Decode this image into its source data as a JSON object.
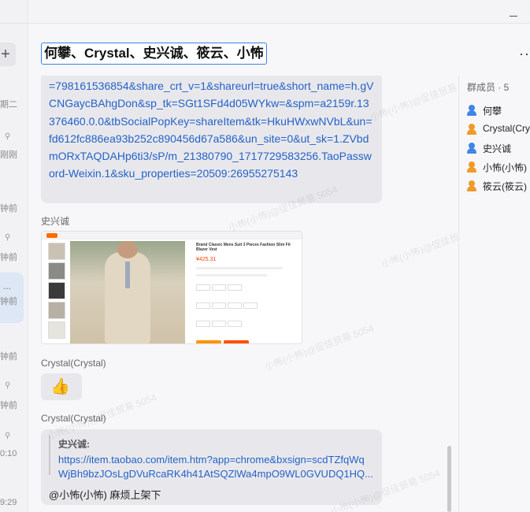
{
  "left_panel": {
    "plus_label": "+",
    "conversations": [
      {
        "name": "",
        "time": "期二"
      },
      {
        "name": "",
        "time": "刚刚"
      },
      {
        "name": "",
        "time": "钟前"
      },
      {
        "name": "",
        "time": "钟前"
      },
      {
        "name": "...",
        "time": "钟前"
      },
      {
        "name": "",
        "time": "钟前"
      },
      {
        "name": "",
        "time": "钟前"
      },
      {
        "name": "",
        "time": "0:10"
      },
      {
        "name": "",
        "time": "9:29"
      }
    ]
  },
  "header": {
    "title": "何攀、Crystal、史兴诚、筱云、小怖",
    "more_label": "··"
  },
  "messages": {
    "link_message": "=798161536854&share_crt_v=1&shareurl=true&short_name=h.gVCNGaycBAhgDon&sp_tk=SGt1SFd4d05WYkw=&spm=a2159r.13376460.0.0&tbSocialPopKey=shareItem&tk=HkuHWxwNVbL&un=fd612fc886ea93b252c890456d67a586&un_site=0&ut_sk=1.ZVbdmORxTAQDAHp6ti3/sP/m_21380790_1717729583256.TaoPassword-Weixin.1&sku_properties=20509:26955275143",
    "image_sender": "史兴诚",
    "image_card": {
      "product_title": "Brand Classic Mens Suit 3 Pieces Fashion Slim Fit Blazer Vest",
      "price": "¥425.31"
    },
    "emoji_sender": "Crystal(Crystal)",
    "emoji": "👍",
    "quote_sender": "Crystal(Crystal)",
    "quote": {
      "from": "史兴诚:",
      "link": "https://item.taobao.com/item.htm?app=chrome&bxsign=scdTZfqWqWjBh9bzJOsLgDVuRcaRK4h41AtSQZlWa4mpO9WL0GVUDQ1HQ...",
      "reply": "@小怖(小怖)  麻烦上架下"
    },
    "watermark": "小怖(小怖)@促佳贸易 5054"
  },
  "members": {
    "heading": "群成员 · 5",
    "list": [
      {
        "name": "何攀",
        "color": "blue"
      },
      {
        "name": "Crystal(Crystal)",
        "color": "orange"
      },
      {
        "name": "史兴诚",
        "color": "blue"
      },
      {
        "name": "小怖(小怖)",
        "color": "orange"
      },
      {
        "name": "筱云(筱云)",
        "color": "orange"
      }
    ]
  },
  "colors": {
    "link": "#2462c8",
    "accent": "#3b82e6",
    "bubble": "#e8e8ec"
  }
}
